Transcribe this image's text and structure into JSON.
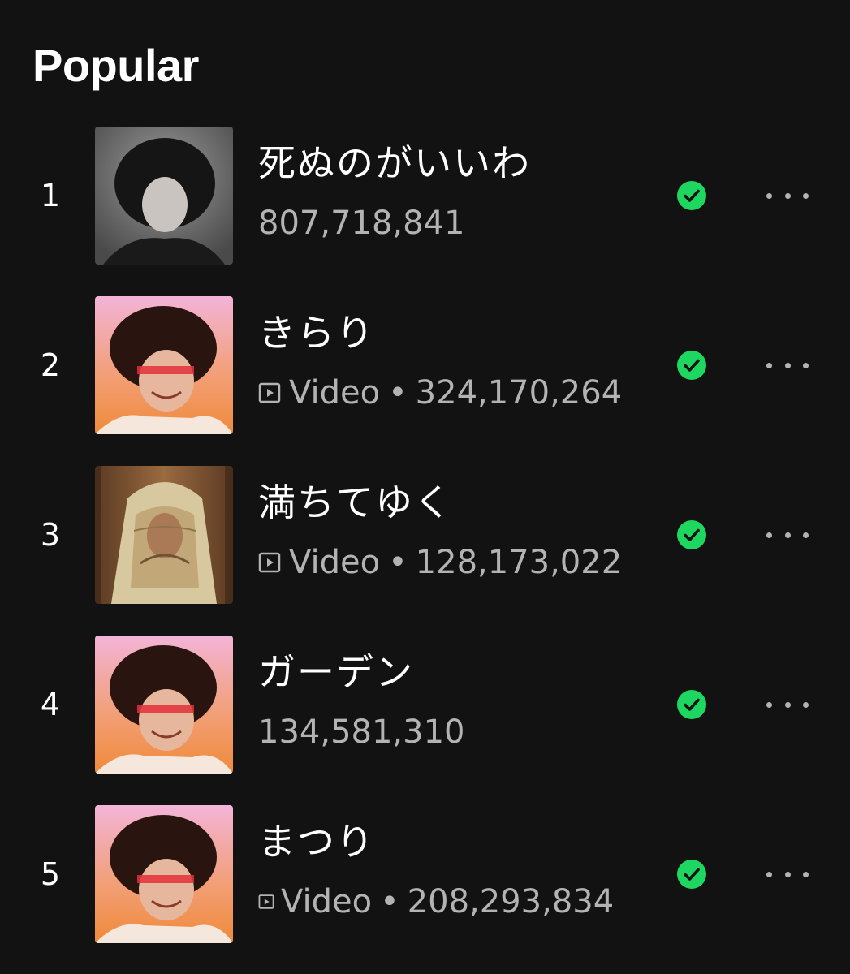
{
  "section": {
    "title": "Popular"
  },
  "tracks": [
    {
      "rank": "1",
      "title": "死ぬのがいいわ",
      "video_label": "",
      "separator": "",
      "plays": "807,718,841",
      "has_video": false,
      "downloaded": true,
      "cover_style": "mono"
    },
    {
      "rank": "2",
      "title": "きらり",
      "video_label": "Video",
      "separator": "•",
      "plays": "324,170,264",
      "has_video": true,
      "downloaded": true,
      "cover_style": "warm"
    },
    {
      "rank": "3",
      "title": "満ちてゆく",
      "video_label": "Video",
      "separator": "•",
      "plays": "128,173,022",
      "has_video": true,
      "downloaded": true,
      "cover_style": "sepia"
    },
    {
      "rank": "4",
      "title": "ガーデン",
      "video_label": "",
      "separator": "",
      "plays": "134,581,310",
      "has_video": false,
      "downloaded": true,
      "cover_style": "warm"
    },
    {
      "rank": "5",
      "title": "まつり",
      "video_label": "Video",
      "separator": "•",
      "plays": "208,293,834",
      "has_video": true,
      "downloaded": true,
      "cover_style": "warm"
    }
  ],
  "colors": {
    "background": "#121212",
    "primary_text": "#ffffff",
    "secondary_text": "#b3b3b3",
    "downloaded_green": "#1ed760"
  },
  "icons": {
    "downloaded": "check-circle-icon",
    "video": "video-icon",
    "more": "more-horizontal-icon"
  }
}
